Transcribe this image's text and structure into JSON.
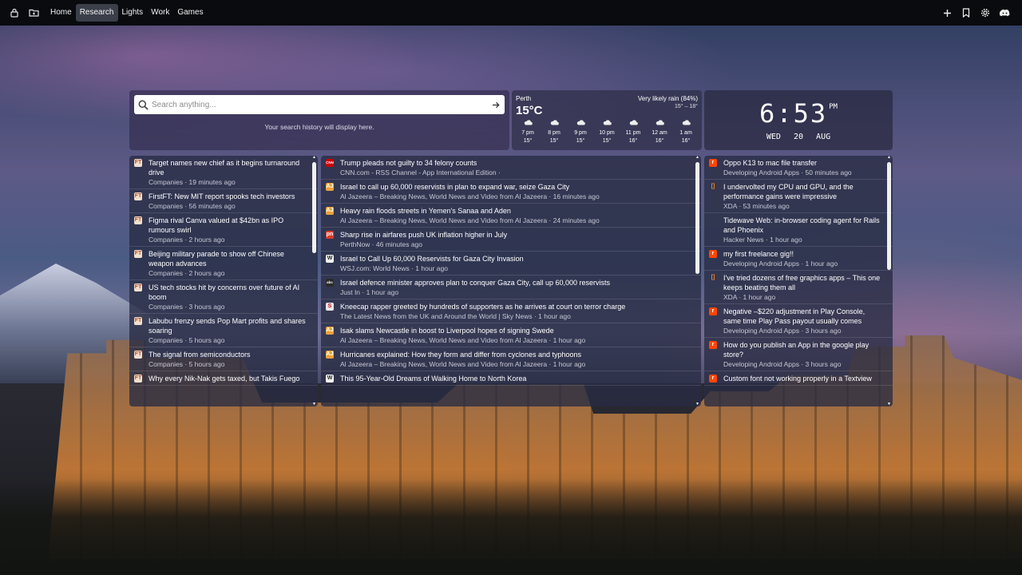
{
  "nav": {
    "icons": [
      "lock-icon",
      "folder-icon"
    ],
    "links": [
      {
        "label": "Home",
        "active": false
      },
      {
        "label": "Research",
        "active": true
      },
      {
        "label": "Lights",
        "active": false
      },
      {
        "label": "Work",
        "active": false
      },
      {
        "label": "Games",
        "active": false
      }
    ],
    "right_icons": [
      "plus-icon",
      "bookmark-icon",
      "gear-icon",
      "discord-icon"
    ]
  },
  "search": {
    "placeholder": "Search anything...",
    "history_text": "Your search history will display here."
  },
  "weather": {
    "city": "Perth",
    "temp": "15°C",
    "condition": "Very likely rain (84%)",
    "range": "15° – 18°",
    "hours": [
      {
        "time": "7 pm",
        "temp": "15°",
        "icon": "cloud-icon"
      },
      {
        "time": "8 pm",
        "temp": "15°",
        "icon": "cloud-icon"
      },
      {
        "time": "9 pm",
        "temp": "15°",
        "icon": "cloud-icon"
      },
      {
        "time": "10 pm",
        "temp": "15°",
        "icon": "cloud-icon"
      },
      {
        "time": "11 pm",
        "temp": "16°",
        "icon": "cloud-icon"
      },
      {
        "time": "12 am",
        "temp": "16°",
        "icon": "cloud-icon"
      },
      {
        "time": "1 am",
        "temp": "16°",
        "icon": "cloud-icon"
      }
    ]
  },
  "clock": {
    "time": "6:53",
    "ampm": "PM",
    "day": "WED",
    "date": "20",
    "month": "AUG"
  },
  "feeds": {
    "left": [
      {
        "title": "Target names new chief as it begins turnaround drive",
        "meta": "Companies · 19 minutes ago",
        "icon": "FT",
        "color": "#f2dfce",
        "fg": "#b0502e"
      },
      {
        "title": "FirstFT: New MIT report spooks tech investors",
        "meta": "Companies · 56 minutes ago",
        "icon": "FT",
        "color": "#f2dfce",
        "fg": "#b0502e"
      },
      {
        "title": "Figma rival Canva valued at $42bn as IPO rumours swirl",
        "meta": "Companies · 2 hours ago",
        "icon": "FT",
        "color": "#f2dfce",
        "fg": "#b0502e"
      },
      {
        "title": "Beijing military parade to show off Chinese weapon advances",
        "meta": "Companies · 2 hours ago",
        "icon": "FT",
        "color": "#f2dfce",
        "fg": "#b0502e"
      },
      {
        "title": "US tech stocks hit by concerns over future of AI boom",
        "meta": "Companies · 3 hours ago",
        "icon": "FT",
        "color": "#f2dfce",
        "fg": "#b0502e"
      },
      {
        "title": "Labubu frenzy sends Pop Mart profits and shares soaring",
        "meta": "Companies · 5 hours ago",
        "icon": "FT",
        "color": "#f2dfce",
        "fg": "#b0502e"
      },
      {
        "title": "The signal from semiconductors",
        "meta": "Companies · 5 hours ago",
        "icon": "FT",
        "color": "#f2dfce",
        "fg": "#b0502e"
      },
      {
        "title": "Why every Nik-Nak gets taxed, but Takis Fuego",
        "meta": "",
        "icon": "FT",
        "color": "#f2dfce",
        "fg": "#b0502e"
      }
    ],
    "middle": [
      {
        "title": "Trump pleads not guilty to 34 felony counts",
        "meta": "CNN.com - RSS Channel - App International Edition ·",
        "icon": "CNN",
        "color": "#cc0000",
        "fg": "#ffffff"
      },
      {
        "title": "Israel to call up 60,000 reservists in plan to expand war, seize Gaza City",
        "meta": "Al Jazeera – Breaking News, World News and Video from Al Jazeera · 16 minutes ago",
        "icon": "AJ",
        "color": "#e8a33c",
        "fg": "#ffffff"
      },
      {
        "title": "Heavy rain floods streets in Yemen's Sanaa and Aden",
        "meta": "Al Jazeera – Breaking News, World News and Video from Al Jazeera · 24 minutes ago",
        "icon": "AJ",
        "color": "#e8a33c",
        "fg": "#ffffff"
      },
      {
        "title": "Sharp rise in airfares push UK inflation higher in July",
        "meta": "PerthNow · 46 minutes ago",
        "icon": "pn",
        "color": "#d93a2b",
        "fg": "#ffffff"
      },
      {
        "title": "Israel to Call Up 60,000 Reservists for Gaza City Invasion",
        "meta": "WSJ.com: World News · 1 hour ago",
        "icon": "W",
        "color": "#f2f2f2",
        "fg": "#222222"
      },
      {
        "title": "Israel defence minister approves plan to conquer Gaza City, call up 60,000 reservists",
        "meta": "Just In · 1 hour ago",
        "icon": "abc",
        "color": "#2b2b2b",
        "fg": "#ffffff"
      },
      {
        "title": "Kneecap rapper greeted by hundreds of supporters as he arrives at court on terror charge",
        "meta": "The Latest News from the UK and Around the World | Sky News · 1 hour ago",
        "icon": "S",
        "color": "#e6e6e6",
        "fg": "#c0001a"
      },
      {
        "title": "Isak slams Newcastle in boost to Liverpool hopes of signing Swede",
        "meta": "Al Jazeera – Breaking News, World News and Video from Al Jazeera · 1 hour ago",
        "icon": "AJ",
        "color": "#e8a33c",
        "fg": "#ffffff"
      },
      {
        "title": "Hurricanes explained: How they form and differ from cyclones and typhoons",
        "meta": "Al Jazeera – Breaking News, World News and Video from Al Jazeera · 1 hour ago",
        "icon": "AJ",
        "color": "#e8a33c",
        "fg": "#ffffff"
      },
      {
        "title": "This 95-Year-Old Dreams of Walking Home to North Korea",
        "meta": "",
        "icon": "W",
        "color": "#f2f2f2",
        "fg": "#222222"
      }
    ],
    "right": [
      {
        "title": "Oppo K13 to mac file transfer",
        "meta": "Developing Android Apps · 50 minutes ago",
        "icon": "r",
        "color": "#ff4500",
        "fg": "#ffffff"
      },
      {
        "title": "I undervolted my CPU and GPU, and the performance gains were impressive",
        "meta": "XDA · 53 minutes ago",
        "icon": "[]",
        "color": "transparent",
        "fg": "#f08a24"
      },
      {
        "title": "Tidewave Web: in-browser coding agent for Rails and Phoenix",
        "meta": "Hacker News · 1 hour ago",
        "icon": "",
        "color": "transparent",
        "fg": "#ffffff"
      },
      {
        "title": "my first freelance gig!!",
        "meta": "Developing Android Apps · 1 hour ago",
        "icon": "r",
        "color": "#ff4500",
        "fg": "#ffffff"
      },
      {
        "title": "I've tried dozens of free graphics apps – This one keeps beating them all",
        "meta": "XDA · 1 hour ago",
        "icon": "[]",
        "color": "transparent",
        "fg": "#f08a24"
      },
      {
        "title": "Negative –$220 adjustment in Play Console, same time Play Pass payout usually comes",
        "meta": "Developing Android Apps · 3 hours ago",
        "icon": "r",
        "color": "#ff4500",
        "fg": "#ffffff"
      },
      {
        "title": "How do you publish an App in the google play store?",
        "meta": "Developing Android Apps · 3 hours ago",
        "icon": "r",
        "color": "#ff4500",
        "fg": "#ffffff"
      },
      {
        "title": "Custom font not working properly in a Textview",
        "meta": "",
        "icon": "r",
        "color": "#ff4500",
        "fg": "#ffffff"
      }
    ]
  }
}
